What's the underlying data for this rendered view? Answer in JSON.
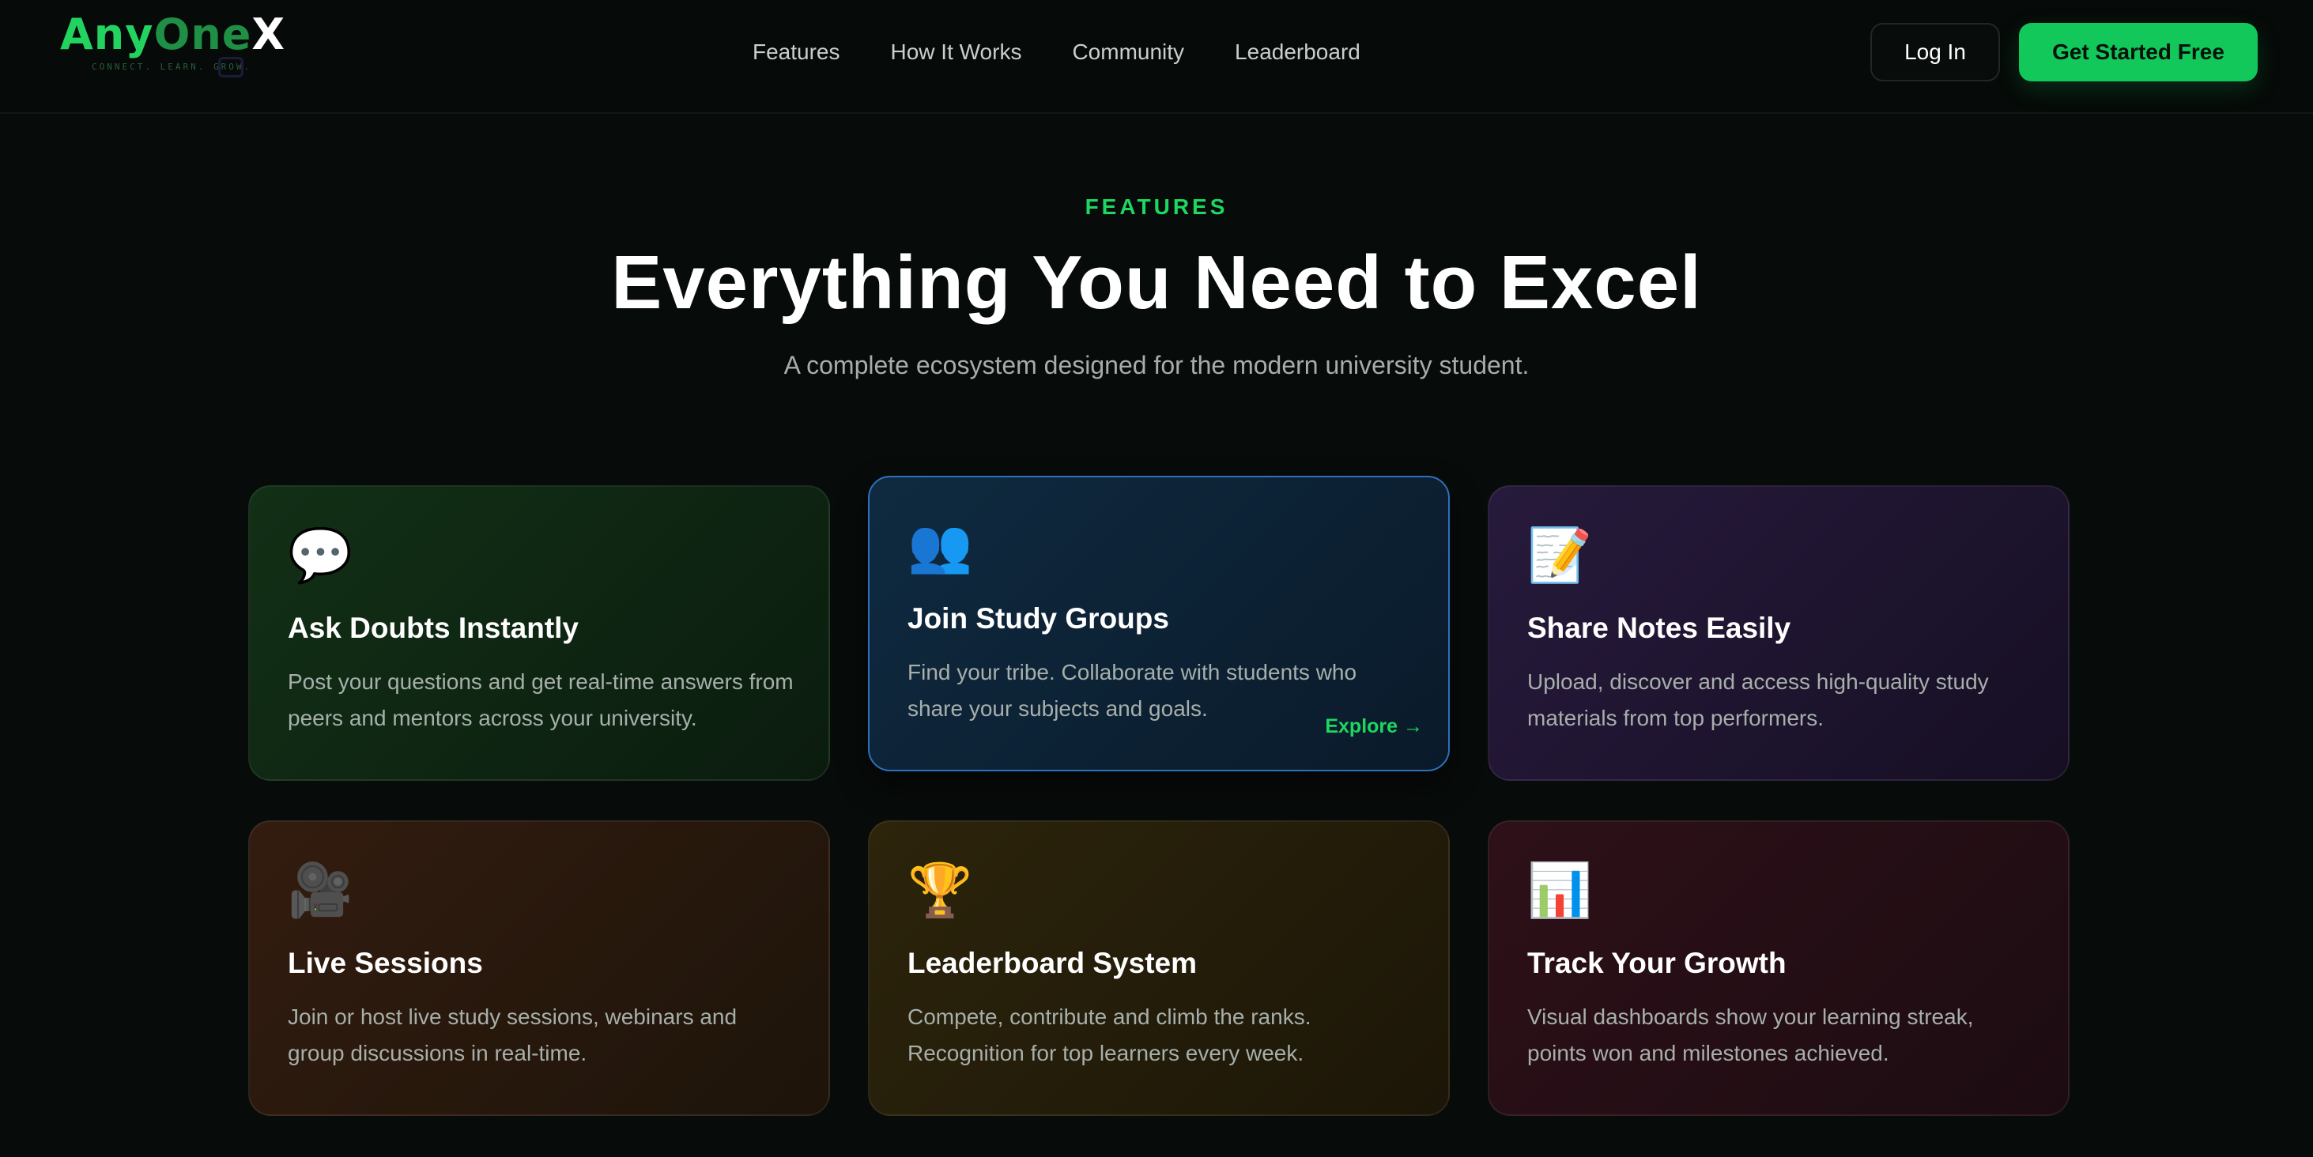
{
  "brand": {
    "name_part1": "Any",
    "name_part2": "One",
    "name_part3": "X",
    "tagline": "CONNECT. LEARN. GROW."
  },
  "nav": {
    "links": [
      "Features",
      "How It Works",
      "Community",
      "Leaderboard"
    ],
    "login_label": "Log In",
    "cta_label": "Get Started Free"
  },
  "hero": {
    "eyebrow": "FEATURES",
    "title": "Everything You Need to Excel",
    "subtitle": "A complete ecosystem designed for the modern university student."
  },
  "features": [
    {
      "icon_name": "speech-bubble-icon",
      "icon": "💬",
      "title": "Ask Doubts Instantly",
      "description": "Post your questions and get real-time answers from peers and mentors across your university."
    },
    {
      "icon_name": "people-icon",
      "icon": "👥",
      "title": "Join Study Groups",
      "description": "Find your tribe. Collaborate with students who share your subjects and goals.",
      "link_label": "Explore →"
    },
    {
      "icon_name": "memo-icon",
      "icon": "📝",
      "title": "Share Notes Easily",
      "description": "Upload, discover and access high-quality study materials from top performers."
    },
    {
      "icon_name": "video-camera-icon",
      "icon": "🎥",
      "title": "Live Sessions",
      "description": "Join or host live study sessions, webinars and group discussions in real-time."
    },
    {
      "icon_name": "trophy-icon",
      "icon": "🏆",
      "title": "Leaderboard System",
      "description": "Compete, contribute and climb the ranks. Recognition for top learners every week."
    },
    {
      "icon_name": "bar-chart-icon",
      "icon": "📊",
      "title": "Track Your Growth",
      "description": "Visual dashboards show your learning streak, points won and milestones achieved."
    }
  ],
  "colors": {
    "background": "#070b09",
    "accent_green": "#12c85a",
    "highlight_border": "#2f6fbe"
  }
}
